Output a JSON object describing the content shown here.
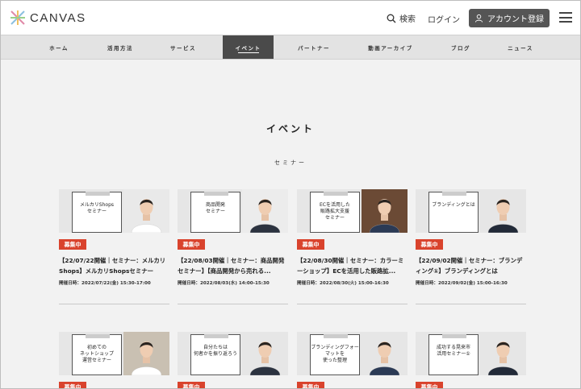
{
  "header": {
    "logo_text": "CANVAS",
    "search_label": "検索",
    "login_label": "ログイン",
    "register_label": "アカウント登録"
  },
  "nav": {
    "items": [
      "ホーム",
      "活用方法",
      "サービス",
      "イベント",
      "パートナー",
      "動画アーカイブ",
      "ブログ",
      "ニュース"
    ],
    "active_index": 3
  },
  "page": {
    "title": "イベント",
    "section": "セミナー"
  },
  "cards": [
    {
      "badge": "募集中",
      "title": "【22/07/22開催｜セミナー：メルカリShops】メルカリShopsセミナー",
      "date": "開催日時：2022/07/22(金) 15:30-17:00",
      "thumb_title": "メルカリShops\nセミナー",
      "thumb_bg": "#e9e9e9"
    },
    {
      "badge": "募集中",
      "title": "【22/08/03開催｜セミナー：商品開発セミナー】【商品開発から売れる...",
      "date": "開催日時：2022/08/03(水) 14:00-15:30",
      "thumb_title": "商品開発\nセミナー",
      "thumb_bg": "#ececec"
    },
    {
      "badge": "募集中",
      "title": "【22/08/30開催｜セミナー：カラーミーショップ】ECを活用した販路拡...",
      "date": "開催日時：2022/08/30(火) 15:00-16:30",
      "thumb_title": "ECを活用した\n販路拡大支援\nセミナー",
      "thumb_bg": "#6b4a35"
    },
    {
      "badge": "募集中",
      "title": "【22/09/02開催｜セミナー：ブランディング①】ブランディングとは",
      "date": "開催日時：2022/09/02(金) 15:00-16:30",
      "thumb_title": "ブランディングとは",
      "thumb_bg": "#e6e6e6"
    },
    {
      "badge": "募集中",
      "title": "",
      "date": "",
      "thumb_title": "初めての\nネットショップ\n運営セミナー",
      "thumb_bg": "#c9c0b2"
    },
    {
      "badge": "募集中",
      "title": "",
      "date": "",
      "thumb_title": "自分たちは\n何者かを振り返ろう",
      "thumb_bg": "#e6e6e6"
    },
    {
      "badge": "募集中",
      "title": "",
      "date": "",
      "thumb_title": "ブランディングフォーマットを\n使った整理",
      "thumb_bg": "#e6e6e6"
    },
    {
      "badge": "募集中",
      "title": "",
      "date": "",
      "thumb_title": "成功する晃来市\n活用セミナー①",
      "thumb_bg": "#e6e6e6"
    }
  ],
  "colors": {
    "badge": "#d9432d",
    "active_nav": "#4a4a4a",
    "register_button": "#555555"
  }
}
